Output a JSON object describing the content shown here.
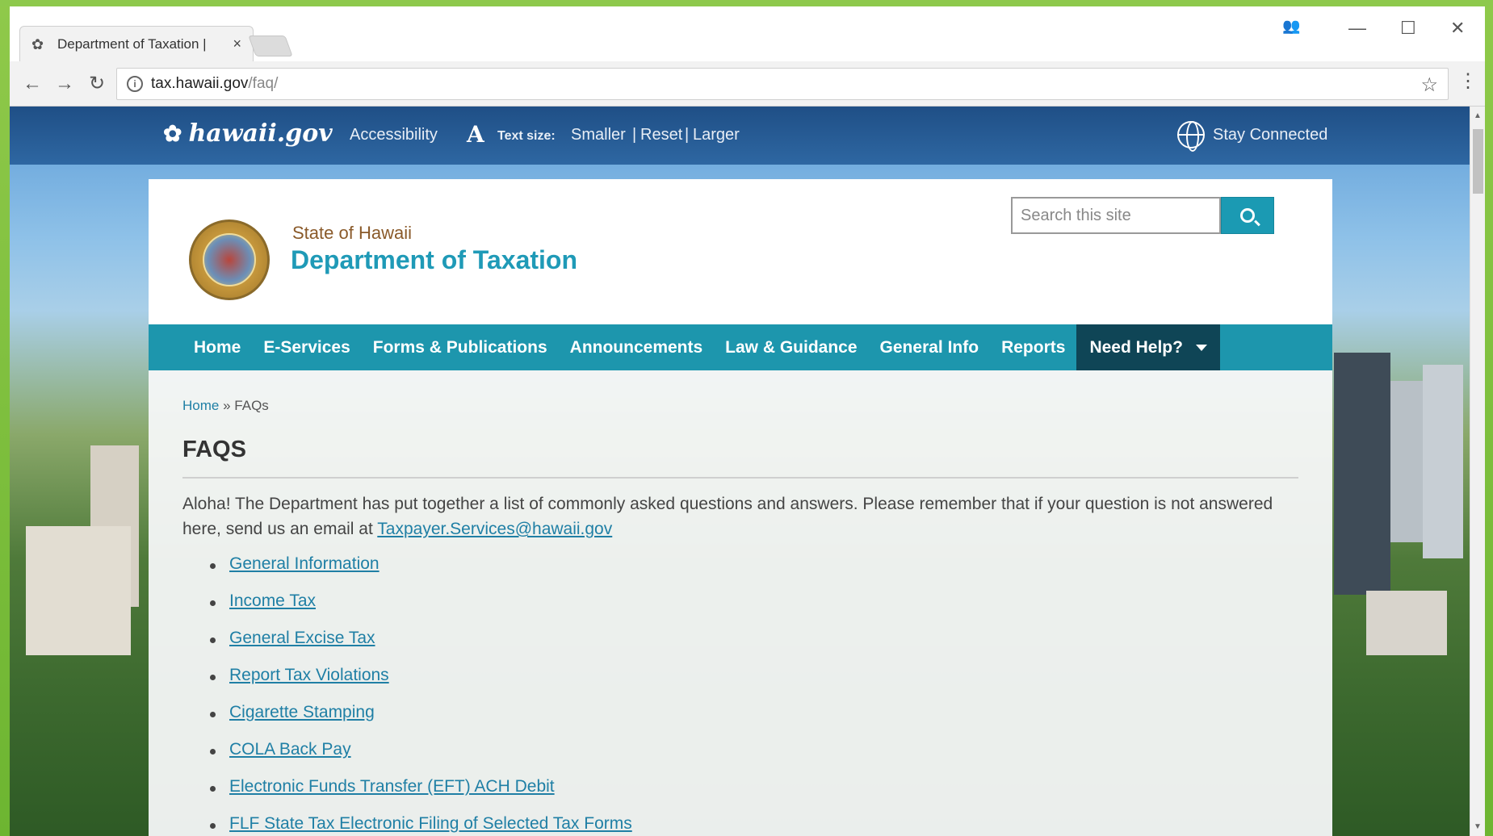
{
  "browser": {
    "tab_title": "Department of Taxation |",
    "tab_close": "×",
    "url_domain": "tax.hawaii.gov",
    "url_path": "/faq/"
  },
  "utility": {
    "logo_text": "hawaii.gov",
    "accessibility": "Accessibility",
    "text_size_label": "Text size:",
    "smaller": "Smaller",
    "separator": "|",
    "reset": "Reset",
    "larger": "Larger",
    "stay_connected": "Stay Connected"
  },
  "header": {
    "state": "State of Hawaii",
    "department": "Department of Taxation",
    "search_placeholder": "Search this site"
  },
  "nav": {
    "items": [
      "Home",
      "E-Services",
      "Forms & Publications",
      "Announcements",
      "Law & Guidance",
      "General Info",
      "Reports"
    ],
    "help": "Need Help?"
  },
  "breadcrumb": {
    "home": "Home",
    "sep": "»",
    "current": "FAQs"
  },
  "page": {
    "title": "FAQS",
    "intro": "Aloha! The Department has put together a list of commonly asked questions and answers. Please remember that if your question is not answered here, send us an email at",
    "email": "Taxpayer.Services@hawaii.gov"
  },
  "faq_links": [
    "General Information",
    "Income Tax",
    "General Excise Tax",
    "Report Tax Violations",
    "Cigarette Stamping",
    "COLA Back Pay",
    "Electronic Funds Transfer (EFT) ACH Debit",
    "FLF State Tax Electronic Filing of Selected Tax Forms"
  ],
  "colors": {
    "teal_nav": "#1d96ad",
    "help_bg": "#0f4556",
    "link": "#1f7fa5",
    "utility_bar": "#2e67a2"
  }
}
